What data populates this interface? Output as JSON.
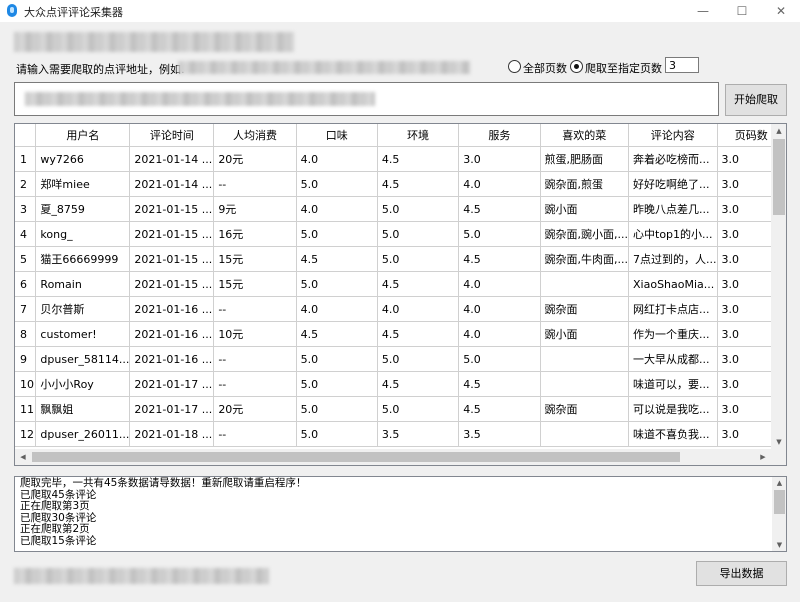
{
  "window": {
    "title": "大众点评评论采集器",
    "min_icon": "minimize-icon",
    "max_icon": "maximize-icon",
    "close_icon": "close-icon"
  },
  "form": {
    "prompt_label": "请输入需要爬取的点评地址，例如:",
    "radio_all_label": "全部页数",
    "radio_page_label": "爬取至指定页数",
    "radio_selected": "page",
    "page_count": "3",
    "start_button": "开始爬取"
  },
  "table": {
    "columns": [
      "",
      "用户名",
      "评论时间",
      "人均消费",
      "口味",
      "环境",
      "服务",
      "喜欢的菜",
      "评论内容",
      "页码数"
    ],
    "rows": [
      [
        "1",
        "wy7266",
        "2021-01-14 ...",
        "20元",
        "4.0",
        "4.5",
        "3.0",
        "煎蛋,肥肠面",
        "奔着必吃榜而...",
        "3.0"
      ],
      [
        "2",
        "郑咩miee",
        "2021-01-14 ...",
        "--",
        "5.0",
        "4.5",
        "4.0",
        "豌杂面,煎蛋",
        "好好吃啊绝了...",
        "3.0"
      ],
      [
        "3",
        "夏_8759",
        "2021-01-15 ...",
        "9元",
        "4.0",
        "5.0",
        "4.5",
        "豌小面",
        "昨晚八点差几...",
        "3.0"
      ],
      [
        "4",
        "kong_",
        "2021-01-15 ...",
        "16元",
        "5.0",
        "5.0",
        "5.0",
        "豌杂面,豌小面,...",
        "心中top1的小...",
        "3.0"
      ],
      [
        "5",
        "猫王66669999",
        "2021-01-15 ...",
        "15元",
        "4.5",
        "5.0",
        "4.5",
        "豌杂面,牛肉面,...",
        "7点过到的，人...",
        "3.0"
      ],
      [
        "6",
        "Romain",
        "2021-01-15 ...",
        "15元",
        "5.0",
        "4.5",
        "4.0",
        "",
        "XiaoShaoMia...",
        "3.0"
      ],
      [
        "7",
        "贝尔普斯",
        "2021-01-16 ...",
        "--",
        "4.0",
        "4.0",
        "4.0",
        "豌杂面",
        "网红打卡点店...",
        "3.0"
      ],
      [
        "8",
        "customer!",
        "2021-01-16 ...",
        "10元",
        "4.5",
        "4.5",
        "4.0",
        "豌小面",
        "作为一个重庆...",
        "3.0"
      ],
      [
        "9",
        "dpuser_58114...",
        "2021-01-16 ...",
        "--",
        "5.0",
        "5.0",
        "5.0",
        "",
        "一大早从成都...",
        "3.0"
      ],
      [
        "10",
        "小小小Roy",
        "2021-01-17 ...",
        "--",
        "5.0",
        "4.5",
        "4.5",
        "",
        "味道可以，要...",
        "3.0"
      ],
      [
        "11",
        "飘飘姐",
        "2021-01-17 ...",
        "20元",
        "5.0",
        "5.0",
        "4.5",
        "豌杂面",
        "可以说是我吃...",
        "3.0"
      ],
      [
        "12",
        "dpuser_26011...",
        "2021-01-18 ...",
        "--",
        "5.0",
        "3.5",
        "3.5",
        "",
        "味道不喜负我...",
        "3.0"
      ]
    ]
  },
  "log": {
    "lines": [
      "爬取完毕，一共有45条数据请导数据！重新爬取请重启程序！",
      "已爬取45条评论",
      "正在爬取第3页",
      "已爬取30条评论",
      "正在爬取第2页",
      "已爬取15条评论"
    ]
  },
  "export_button": "导出数据",
  "colors": {
    "window_bg": "#f0f0f0",
    "accent": "#1e88e5",
    "grid_line": "#d0d0d0"
  }
}
